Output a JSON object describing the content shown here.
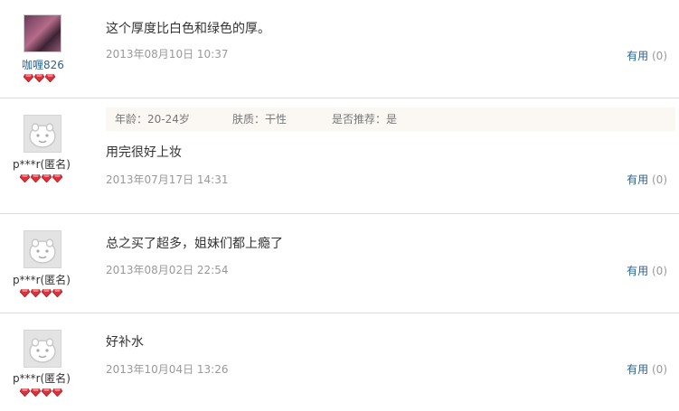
{
  "reviews": [
    {
      "user": "咖喱826",
      "avatar": "user-photo",
      "content": "这个厚度比白色和绿色的厚。",
      "date": "2013年08月10日 10:37",
      "useful_label": "有用",
      "useful_count": "(0)",
      "gems": 3
    },
    {
      "user": "p***r(匿名)",
      "avatar": "default-face",
      "info": {
        "age": "年龄：20-24岁",
        "skin": "肤质：干性",
        "recommend": "是否推荐：是"
      },
      "content": "用完很好上妆",
      "date": "2013年07月17日 14:31",
      "useful_label": "有用",
      "useful_count": "(0)",
      "gems": 4
    },
    {
      "user": "p***r(匿名)",
      "avatar": "default-face",
      "content": "总之买了超多，姐妹们都上瘾了",
      "date": "2013年08月02日 22:54",
      "useful_label": "有用",
      "useful_count": "(0)",
      "gems": 4
    },
    {
      "user": "p***r(匿名)",
      "avatar": "default-face",
      "content": "好补水",
      "date": "2013年10月04日 13:26",
      "useful_label": "有用",
      "useful_count": "(0)",
      "gems": 4
    }
  ],
  "colors": {
    "link": "#2a6496",
    "gem": "#d9323b",
    "divider": "#dcdcdc",
    "meta": "#999999"
  }
}
